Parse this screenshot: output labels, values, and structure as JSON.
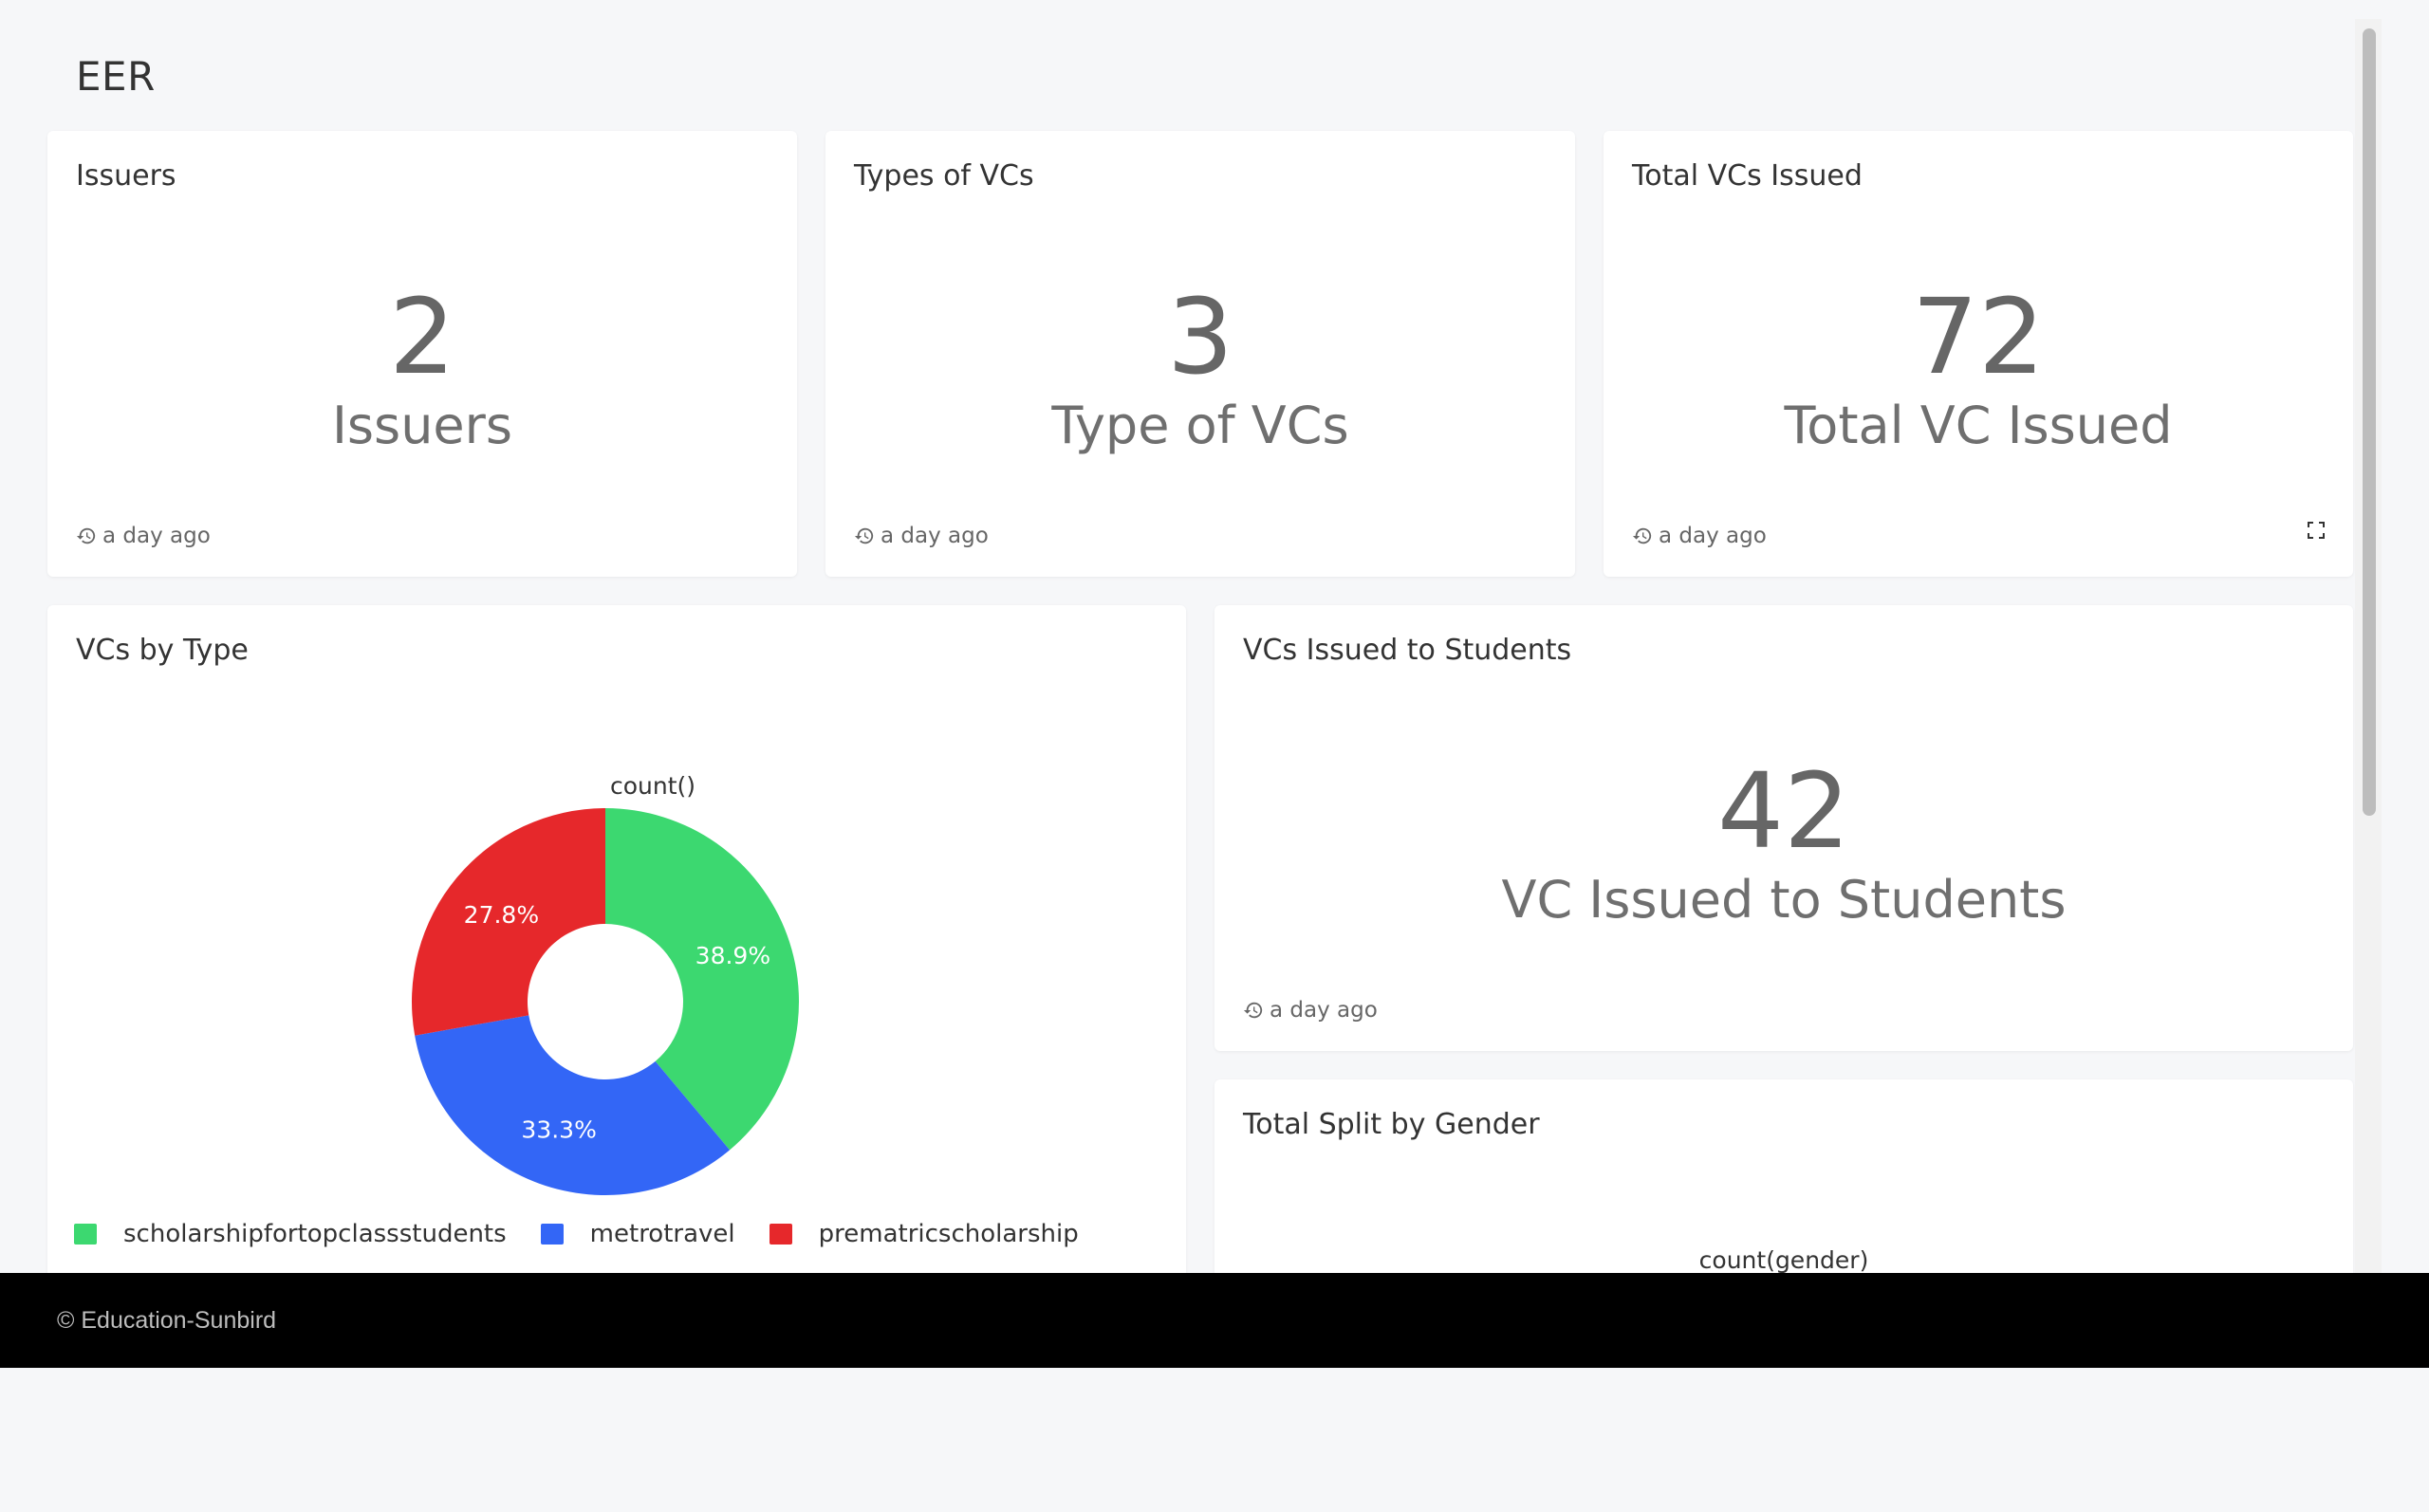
{
  "dashboard": {
    "title": "EER"
  },
  "cards": {
    "issuers": {
      "title": "Issuers",
      "value": "2",
      "subtitle": "Issuers",
      "timestamp": "a day ago"
    },
    "types": {
      "title": "Types of VCs",
      "value": "3",
      "subtitle": "Type of VCs",
      "timestamp": "a day ago"
    },
    "total": {
      "title": "Total VCs Issued",
      "value": "72",
      "subtitle": "Total VC Issued",
      "timestamp": "a day ago"
    },
    "students": {
      "title": "VCs Issued to Students",
      "value": "42",
      "subtitle": "VC Issued to Students",
      "timestamp": "a day ago"
    },
    "by_type": {
      "title": "VCs by Type"
    },
    "gender": {
      "title": "Total Split by Gender",
      "chart_label": "count(gender)"
    }
  },
  "icons": {
    "timestamp": "history-icon",
    "expand": "expand-icon"
  },
  "chart_data": {
    "type": "pie",
    "title": "count()",
    "categories": [
      "scholarshipfortopclassstudents",
      "metrotravel",
      "prematricscholarship"
    ],
    "values": [
      38.9,
      33.3,
      27.8
    ],
    "unit": "%",
    "colors": [
      "#3cd870",
      "#3366f6",
      "#e6282b"
    ],
    "donut": true,
    "legend_position": "bottom"
  },
  "footer": {
    "text": "© Education-Sunbird"
  }
}
